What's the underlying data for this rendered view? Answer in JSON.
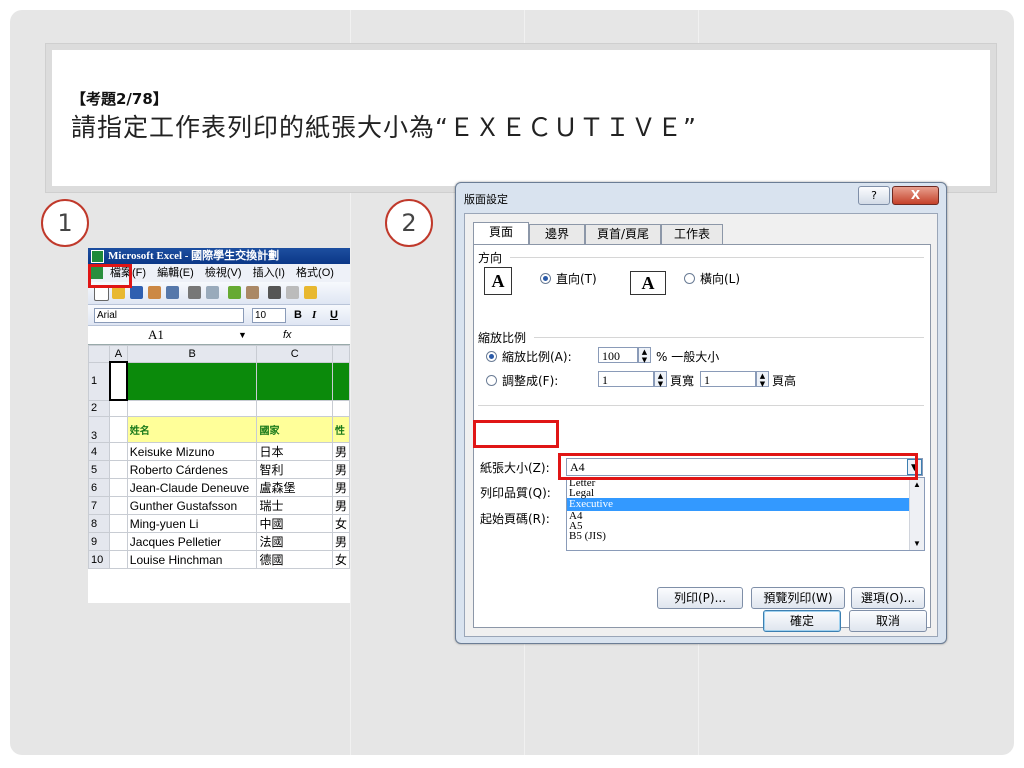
{
  "slide": {
    "small_title": "【考題2/78】",
    "main_title": "請指定工作表列印的紙張大小為“ＥＸＥＣＵＴＩＶＥ”",
    "step1": "1",
    "step2": "2"
  },
  "excel": {
    "window_title": "Microsoft Excel - 國際學生交換計劃",
    "menu": [
      "檔案(F)",
      "編輯(E)",
      "檢視(V)",
      "插入(I)",
      "格式(O)"
    ],
    "font_name": "Arial",
    "font_size": "10",
    "bold": "B",
    "italic": "I",
    "underline": "U",
    "name_box": "A1",
    "fx": "fx",
    "columns": [
      "A",
      "B",
      "C"
    ],
    "rows": [
      {
        "n": "1",
        "b": "",
        "c": ""
      },
      {
        "n": "2",
        "b": "",
        "c": ""
      },
      {
        "n": "3",
        "b": "姓名",
        "c": "國家"
      },
      {
        "n": "4",
        "b": "Keisuke Mizuno",
        "c": "日本"
      },
      {
        "n": "5",
        "b": "Roberto Cárdenes",
        "c": "智利"
      },
      {
        "n": "6",
        "b": "Jean-Claude Deneuve",
        "c": "盧森堡"
      },
      {
        "n": "7",
        "b": "Gunther Gustafsson",
        "c": "瑞士"
      },
      {
        "n": "8",
        "b": "Ming-yuen Li",
        "c": "中國"
      },
      {
        "n": "9",
        "b": "Jacques Pelletier",
        "c": "法國"
      },
      {
        "n": "10",
        "b": "Louise Hinchman",
        "c": "德國"
      }
    ]
  },
  "dialog": {
    "title": "版面設定",
    "help": "?",
    "close": "X",
    "tabs": [
      "頁面",
      "邊界",
      "頁首/頁尾",
      "工作表"
    ],
    "orientation_label": "方向",
    "portrait": "直向(T)",
    "landscape": "橫向(L)",
    "scaling_label": "縮放比例",
    "adjust_to": "縮放比例(A):",
    "adjust_value": "100",
    "adjust_suffix": "% 一般大小",
    "fit_to": "調整成(F):",
    "fit_wide": "1",
    "fit_wide_suffix": "頁寬",
    "fit_tall": "1",
    "fit_tall_suffix": "頁高",
    "paper_size_label": "紙張大小(Z):",
    "paper_size_value": "A4",
    "print_quality_label": "列印品質(Q):",
    "first_page_label": "起始頁碼(R):",
    "paper_options": [
      "Letter",
      "Legal",
      "Executive",
      "A4",
      "A5",
      "B5 (JIS)"
    ],
    "selected_option": "Executive",
    "print_btn": "列印(P)...",
    "preview_btn": "預覽列印(W)",
    "options_btn": "選項(O)...",
    "ok_btn": "確定",
    "cancel_btn": "取消"
  }
}
